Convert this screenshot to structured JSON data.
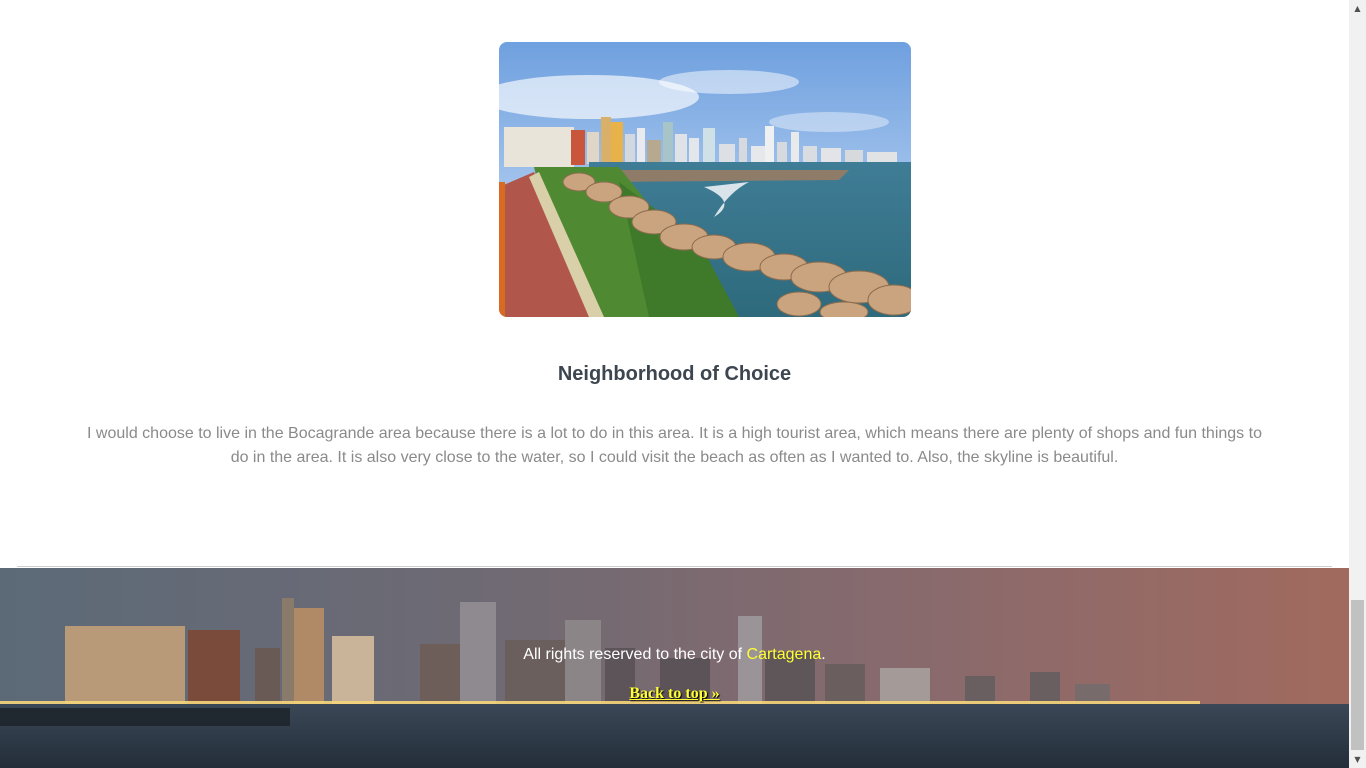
{
  "main": {
    "photo_description": "Bocagrande waterfront skyline",
    "section_title": "Neighborhood of Choice",
    "section_body": "I would choose to live in the Bocagrande area because there is a lot to do in this area. It is a high tourist area, which means there are plenty of shops and fun things to do in the area. It is also very close to the water, so I could visit the beach as often as I wanted to. Also, the skyline is beautiful."
  },
  "footer": {
    "rights_text": "All rights reserved to the city of",
    "city_link": "Cartagena",
    "rights_end": ".",
    "back_to_top": "Back to top »"
  },
  "scrollbar": {
    "up_icon": "scroll-up-arrow-icon",
    "down_icon": "scroll-down-arrow-icon"
  },
  "colors": {
    "heading": "#3d4650",
    "body_text": "#8a8a8a",
    "footer_link": "#ffff33"
  }
}
